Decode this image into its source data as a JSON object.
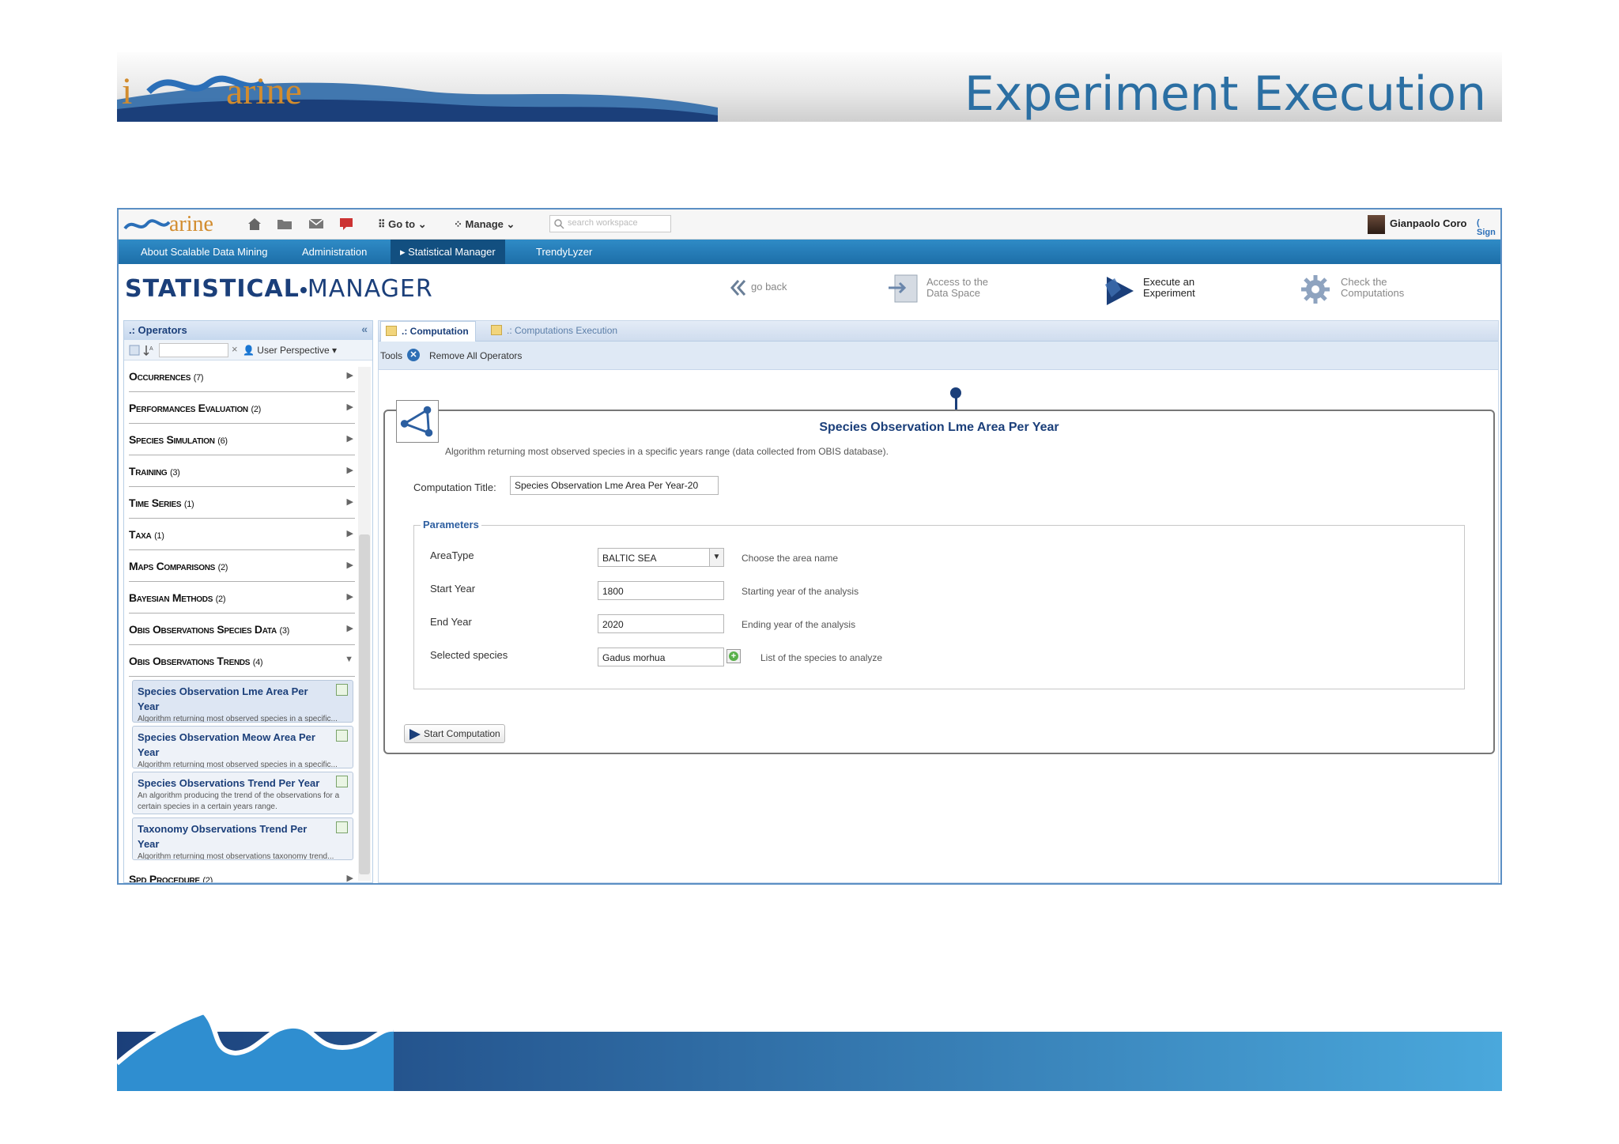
{
  "slide": {
    "brand_i": "i",
    "brand_arine": "arine",
    "title": "Experiment Execution"
  },
  "topbar": {
    "brand": "iMarine",
    "goto_label": "Go to",
    "manage_label": "Manage",
    "search_placeholder": "search workspace",
    "user_name": "Gianpaolo Coro",
    "sign_out": "( Sign"
  },
  "nav": {
    "items": [
      "About Scalable Data Mining",
      "Administration",
      "Statistical Manager",
      "TrendyLyzer"
    ],
    "active_index": 2
  },
  "sm_header": {
    "logo_left": "STATISTICAL",
    "logo_right": "MANAGER",
    "actions": [
      {
        "label": "go back"
      },
      {
        "label": "Access to the\nData Space",
        "line1": "Access to the",
        "line2": "Data Space"
      },
      {
        "label": "Execute an Experiment",
        "line1": "Execute an",
        "line2": "Experiment"
      },
      {
        "label": "Check the Computations",
        "line1": "Check the",
        "line2": "Computations"
      }
    ]
  },
  "operators_panel": {
    "title": ".: Operators",
    "perspective": "User Perspective",
    "categories": [
      {
        "name": "Occurrences",
        "count": "(7)"
      },
      {
        "name": "Performances Evaluation",
        "count": "(2)"
      },
      {
        "name": "Species Simulation",
        "count": "(6)"
      },
      {
        "name": "Training",
        "count": "(3)"
      },
      {
        "name": "Time Series",
        "count": "(1)"
      },
      {
        "name": "Taxa",
        "count": "(1)"
      },
      {
        "name": "Maps Comparisons",
        "count": "(2)"
      },
      {
        "name": "Bayesian Methods",
        "count": "(2)"
      },
      {
        "name": "Obis Observations Species Data",
        "count": "(3)"
      },
      {
        "name": "Obis Observations Trends",
        "count": "(4)"
      }
    ],
    "operators": [
      {
        "title": "Species Observation Lme Area Per Year",
        "desc": "Algorithm returning most observed species in a specific..."
      },
      {
        "title": "Species Observation Meow Area Per Year",
        "desc": "Algorithm returning most observed species in a specific..."
      },
      {
        "title": "Species Observations Trend Per Year",
        "desc": "An algorithm producing the trend of the observations for a certain species in a certain years range."
      },
      {
        "title": "Taxonomy Observations Trend Per Year",
        "desc": "Algorithm returning most observations taxonomy trend..."
      }
    ],
    "last_category": {
      "name": "Spd Procedure",
      "count": "(2)"
    }
  },
  "main": {
    "tabs": [
      ".: Computation",
      ".: Computations Execution"
    ],
    "tools_label": "Tools",
    "remove_all": "Remove All Operators",
    "computation": {
      "title": "Species Observation Lme Area Per Year",
      "description": "Algorithm returning most observed species in a specific years range (data collected from OBIS database).",
      "title_label": "Computation Title:",
      "title_value": "Species Observation Lme Area Per Year-20",
      "parameters_label": "Parameters",
      "params": [
        {
          "label": "AreaType",
          "value": "BALTIC SEA",
          "help": "Choose the area name"
        },
        {
          "label": "Start Year",
          "value": "1800",
          "help": "Starting year of the analysis"
        },
        {
          "label": "End Year",
          "value": "2020",
          "help": "Ending year of the analysis"
        },
        {
          "label": "Selected species",
          "value": "Gadus morhua",
          "help": "List of the species to analyze"
        }
      ],
      "start_button": "Start Computation"
    }
  },
  "colors": {
    "brand_blue": "#1b3f7a",
    "nav_blue": "#1d6ea8",
    "title_blue": "#2b6fa3",
    "brand_orange": "#d28c2e"
  }
}
